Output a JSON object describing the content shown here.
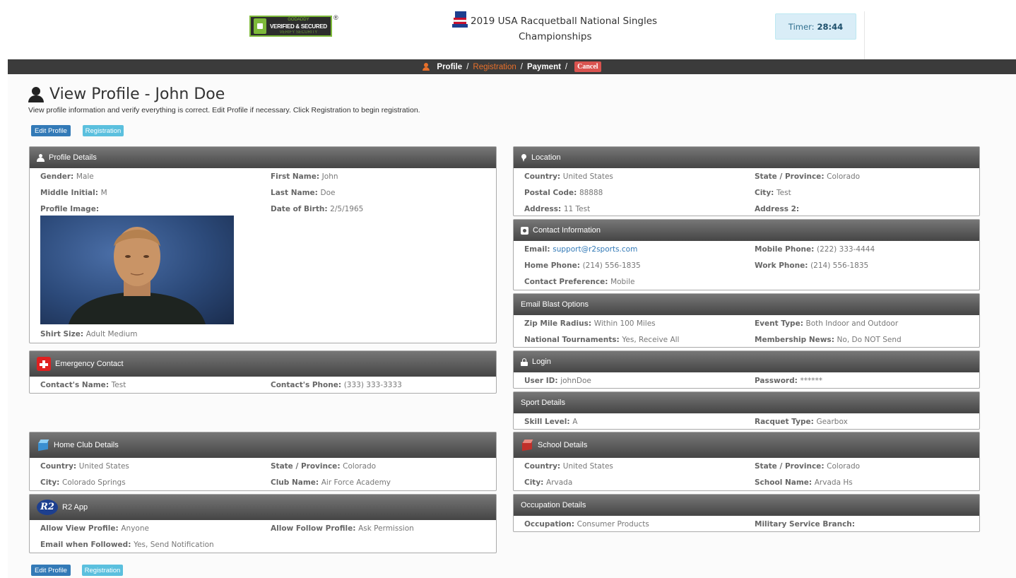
{
  "header": {
    "badge_top": "GODADDY",
    "badge_main": "VERIFIED & SECURED",
    "badge_bottom": "VERIFY SECURITY",
    "registered_mark": "®",
    "event_title_line1": "2019 USA Racquetball National Singles",
    "event_title_line2": "Championships",
    "timer_label": "Timer:",
    "timer_value": "28:44"
  },
  "nav": {
    "profile": "Profile",
    "registration": "Registration",
    "payment": "Payment",
    "cancel": "Cancel",
    "separator": "/"
  },
  "page": {
    "title": "View Profile - John Doe",
    "subtitle": "View profile information and verify everything is correct. Edit Profile if necessary. Click Registration to begin registration.",
    "edit_button": "Edit Profile",
    "registration_button": "Registration"
  },
  "profile_details": {
    "heading": "Profile Details",
    "gender_label": "Gender",
    "gender": "Male",
    "first_name_label": "First Name",
    "first_name": "John",
    "middle_initial_label": "Middle Initial",
    "middle_initial": "M",
    "last_name_label": "Last Name",
    "last_name": "Doe",
    "profile_image_label": "Profile Image",
    "dob_label": "Date of Birth",
    "dob": "2/5/1965",
    "shirt_label": "Shirt Size",
    "shirt": "Adult Medium"
  },
  "emergency": {
    "heading": "Emergency Contact",
    "name_label": "Contact's Name",
    "name": "Test",
    "phone_label": "Contact's Phone",
    "phone": "(333) 333-3333"
  },
  "home_club": {
    "heading": "Home Club Details",
    "country_label": "Country",
    "country": "United States",
    "state_label": "State / Province",
    "state": "Colorado",
    "city_label": "City",
    "city": "Colorado Springs",
    "club_label": "Club Name",
    "club": "Air Force Academy"
  },
  "r2app": {
    "heading": "R2 App",
    "logo_text": "R2",
    "view_label": "Allow View Profile",
    "view": "Anyone",
    "follow_label": "Allow Follow Profile",
    "follow": "Ask Permission",
    "email_label": "Email when Followed",
    "email": "Yes, Send Notification"
  },
  "location": {
    "heading": "Location",
    "country_label": "Country",
    "country": "United States",
    "state_label": "State / Province",
    "state": "Colorado",
    "postal_label": "Postal Code",
    "postal": "88888",
    "city_label": "City",
    "city": "Test",
    "address_label": "Address",
    "address": "11 Test",
    "address2_label": "Address 2",
    "address2": ""
  },
  "contact": {
    "heading": "Contact Information",
    "email_label": "Email",
    "email": "support@r2sports.com",
    "mobile_label": "Mobile Phone",
    "mobile": "(222) 333-4444",
    "home_label": "Home Phone",
    "home": "(214) 556-1835",
    "work_label": "Work Phone",
    "work": "(214) 556-1835",
    "pref_label": "Contact Preference",
    "pref": "Mobile"
  },
  "email_blast": {
    "heading": "Email Blast Options",
    "zip_label": "Zip Mile Radius",
    "zip": "Within 100 Miles",
    "event_label": "Event Type",
    "event": "Both Indoor and Outdoor",
    "national_label": "National Tournaments",
    "national": "Yes, Receive All",
    "news_label": "Membership News",
    "news": "No, Do NOT Send"
  },
  "login": {
    "heading": "Login",
    "user_label": "User ID",
    "user": "johnDoe",
    "pass_label": "Password",
    "pass": "******"
  },
  "sport": {
    "heading": "Sport Details",
    "skill_label": "Skill Level",
    "skill": "A",
    "racquet_label": "Racquet Type",
    "racquet": "Gearbox"
  },
  "school": {
    "heading": "School Details",
    "country_label": "Country",
    "country": "United States",
    "state_label": "State / Province",
    "state": "Colorado",
    "city_label": "City",
    "city": "Arvada",
    "name_label": "School Name",
    "name": "Arvada Hs"
  },
  "occupation": {
    "heading": "Occupation Details",
    "occ_label": "Occupation",
    "occ": "Consumer Products",
    "mil_label": "Military Service Branch",
    "mil": ""
  },
  "colors": {
    "nav_bg": "#3b3b3b",
    "accent_orange": "#e8702a",
    "cancel_red": "#d9534f",
    "primary_blue": "#337ab7",
    "info_blue": "#5bc0de"
  }
}
